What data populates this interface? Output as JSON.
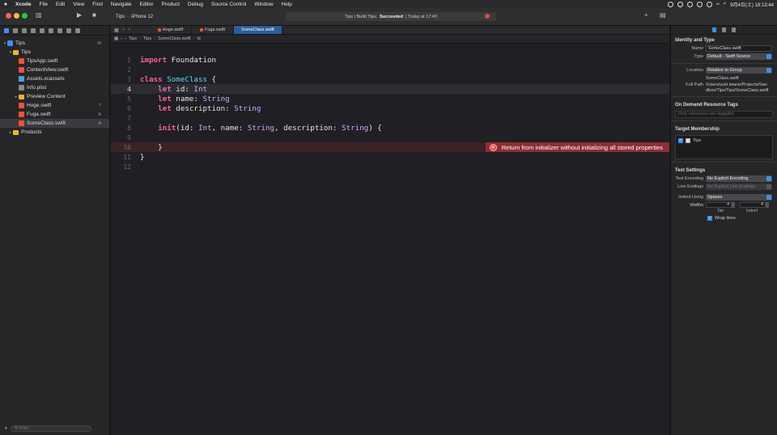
{
  "menubar": {
    "app": "Xcode",
    "items": [
      "File",
      "Edit",
      "View",
      "Find",
      "Navigate",
      "Editor",
      "Product",
      "Debug",
      "Source Control",
      "Window",
      "Help"
    ],
    "clock": "9月4日(土) 18:13:44"
  },
  "toolbar": {
    "scheme": "Tips",
    "destination": "iPhone 12",
    "activity_prefix": "Tips | Build Tips: ",
    "activity_status": "Succeeded",
    "activity_suffix": " | Today at 17:43"
  },
  "navigator": {
    "items": [
      {
        "name": "Tips",
        "kind": "proj",
        "indent": 0,
        "chev": "▾",
        "badge": "M"
      },
      {
        "name": "Tips",
        "kind": "folder",
        "indent": 1,
        "chev": "▾",
        "badge": ""
      },
      {
        "name": "TipsApp.swift",
        "kind": "swift",
        "indent": 2,
        "chev": "",
        "badge": ""
      },
      {
        "name": "ContentView.swift",
        "kind": "swift",
        "indent": 2,
        "chev": "",
        "badge": ""
      },
      {
        "name": "Assets.xcassets",
        "kind": "assets",
        "indent": 2,
        "chev": "",
        "badge": ""
      },
      {
        "name": "Info.plist",
        "kind": "plist",
        "indent": 2,
        "chev": "",
        "badge": ""
      },
      {
        "name": "Preview Content",
        "kind": "folder",
        "indent": 2,
        "chev": "▸",
        "badge": ""
      },
      {
        "name": "Hoge.swift",
        "kind": "swift",
        "indent": 2,
        "chev": "",
        "badge": "?"
      },
      {
        "name": "Fuga.swift",
        "kind": "swift",
        "indent": 2,
        "chev": "",
        "badge": "A"
      },
      {
        "name": "SomeClass.swift",
        "kind": "swift",
        "indent": 2,
        "chev": "",
        "badge": "A",
        "selected": true
      },
      {
        "name": "Products",
        "kind": "folder",
        "indent": 1,
        "chev": "▸",
        "badge": ""
      }
    ],
    "filter_placeholder": "Filter"
  },
  "editor": {
    "tabs": [
      "Hoge.swift",
      "Fuga.swift",
      "SomeClass.swift"
    ],
    "active_tab": 2,
    "breadcrumbs": [
      "Tips",
      "Tips",
      "SomeClass.swift",
      "id"
    ],
    "current_line": 4,
    "error_line": 10,
    "error_message": "Return from initializer without initializing all stored properties",
    "lines": [
      [
        [
          "kw",
          "import"
        ],
        [
          "",
          " Foundation"
        ]
      ],
      [],
      [
        [
          "kw",
          "class"
        ],
        [
          "",
          " "
        ],
        [
          "cl",
          "SomeClass"
        ],
        [
          "",
          " {"
        ]
      ],
      [
        [
          "",
          "    "
        ],
        [
          "kw",
          "let"
        ],
        [
          "",
          " id: "
        ],
        [
          "ty",
          "Int"
        ]
      ],
      [
        [
          "",
          "    "
        ],
        [
          "kw",
          "let"
        ],
        [
          "",
          " name: "
        ],
        [
          "ty",
          "String"
        ]
      ],
      [
        [
          "",
          "    "
        ],
        [
          "kw",
          "let"
        ],
        [
          "",
          " description: "
        ],
        [
          "ty",
          "String"
        ]
      ],
      [],
      [
        [
          "",
          "    "
        ],
        [
          "kw",
          "init"
        ],
        [
          "",
          "(id: "
        ],
        [
          "ty",
          "Int"
        ],
        [
          "",
          ", name: "
        ],
        [
          "ty",
          "String"
        ],
        [
          "",
          ", description: "
        ],
        [
          "ty",
          "String"
        ],
        [
          "",
          ") {"
        ]
      ],
      [],
      [
        [
          "",
          "    }"
        ]
      ],
      [
        [
          "",
          "}"
        ]
      ],
      []
    ]
  },
  "inspector": {
    "identity_title": "Identity and Type",
    "name_label": "Name",
    "name_value": "SomeClass.swift",
    "type_label": "Type",
    "type_value": "Default - Swift Source",
    "location_label": "Location",
    "location_value": "Relative to Group",
    "location_file": "SomeClass.swift",
    "fullpath_label": "Full Path",
    "fullpath_value": "/Users/yuki.iwane/Projects/Sandbox/Tips/Tips/SomeClass.swift",
    "odr_title": "On Demand Resource Tags",
    "odr_placeholder": "Only resources are taggable",
    "membership_title": "Target Membership",
    "membership_target": "Tips",
    "text_title": "Text Settings",
    "encoding_label": "Text Encoding",
    "encoding_value": "No Explicit Encoding",
    "endings_label": "Line Endings",
    "endings_value": "No Explicit Line Endings",
    "indent_label": "Indent Using",
    "indent_value": "Spaces",
    "widths_label": "Widths",
    "tab_width": "4",
    "indent_width": "4",
    "tab_sublabel": "Tab",
    "indent_sublabel": "Indent",
    "wrap_label": "Wrap lines"
  }
}
